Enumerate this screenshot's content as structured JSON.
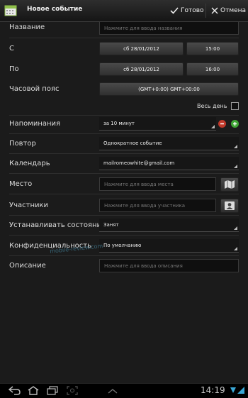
{
  "header": {
    "title": "Новое событие",
    "done_label": "Готово",
    "cancel_label": "Отмена"
  },
  "form": {
    "title_label": "Название",
    "title_placeholder": "Нажмите для ввода названия",
    "from_label": "С",
    "from_date": "сб 28/01/2012",
    "from_time": "15:00",
    "to_label": "По",
    "to_date": "сб 28/01/2012",
    "to_time": "16:00",
    "timezone_label": "Часовой пояс",
    "timezone_value": "(GMT+0:00) GMT+00:00",
    "allday_label": "Весь день",
    "allday_checked": false,
    "reminders_label": "Напоминания",
    "reminder_value": "за 10 минут",
    "repeat_label": "Повтор",
    "repeat_value": "Однократное событие",
    "calendar_label": "Календарь",
    "calendar_value": "mailromeowhite@gmail.com",
    "location_label": "Место",
    "location_placeholder": "Нажмите для ввода места",
    "participants_label": "Участники",
    "participants_placeholder": "Нажмите для ввода участника",
    "status_label": "Устанавливать состояние",
    "status_value": "Занят",
    "privacy_label": "Конфиденциальность",
    "privacy_value": "По умолчанию",
    "description_label": "Описание",
    "description_placeholder": "Нажмите для ввода описания"
  },
  "watermark": "mobile-review.com",
  "statusbar": {
    "clock": "14:19"
  },
  "colors": {
    "background": "#1b1b1b",
    "remove_button": "#c0392b",
    "add_button": "#3fa535",
    "accent": "#3aa7d6"
  }
}
